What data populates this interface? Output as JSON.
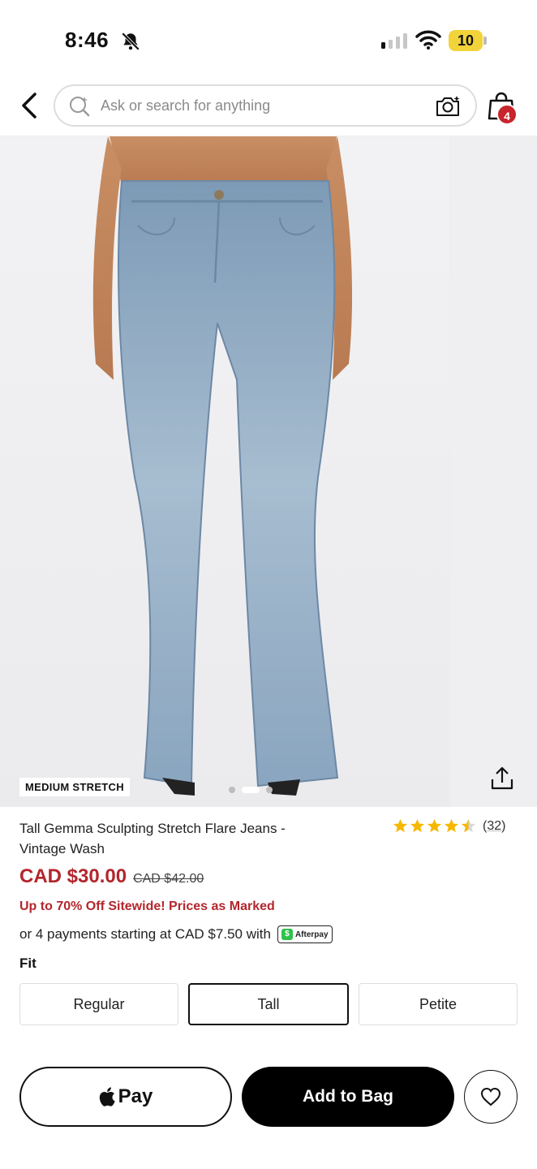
{
  "status_bar": {
    "time": "8:46",
    "battery_level": "10",
    "icons": [
      "bell-slash-icon",
      "cellular-signal-icon",
      "wifi-icon",
      "battery-icon"
    ]
  },
  "header": {
    "search_placeholder": "Ask or search for anything",
    "bag_count": "4",
    "icons": [
      "back-icon",
      "search-sparkle-icon",
      "camera-search-icon",
      "shopping-bag-icon"
    ]
  },
  "gallery": {
    "badge": "MEDIUM STRETCH",
    "image_count": 3,
    "active_index": 1,
    "icons": [
      "share-icon"
    ]
  },
  "product": {
    "title": "Tall Gemma Sculpting Stretch Flare Jeans - Vintage Wash",
    "rating": 4.5,
    "review_count": "(32)",
    "price_sale": "CAD $30.00",
    "price_original": "CAD $42.00",
    "promo": "Up to 70% Off Sitewide! Prices as Marked",
    "installments_text": "or 4 payments starting at CAD $7.50 with",
    "afterpay_label": "Afterpay"
  },
  "fit": {
    "label": "Fit",
    "options": [
      "Regular",
      "Tall",
      "Petite"
    ],
    "selected": "Tall"
  },
  "actions": {
    "applepay_label": "Pay",
    "add_to_bag_label": "Add to Bag",
    "icons": [
      "apple-icon",
      "heart-icon"
    ]
  },
  "colors": {
    "sale_red": "#b3262d",
    "badge_red": "#c8242b",
    "star_yellow": "#f5b800",
    "battery_yellow": "#f2d33a",
    "afterpay_green": "#2ec24c",
    "denim": "#7f9cb8"
  }
}
